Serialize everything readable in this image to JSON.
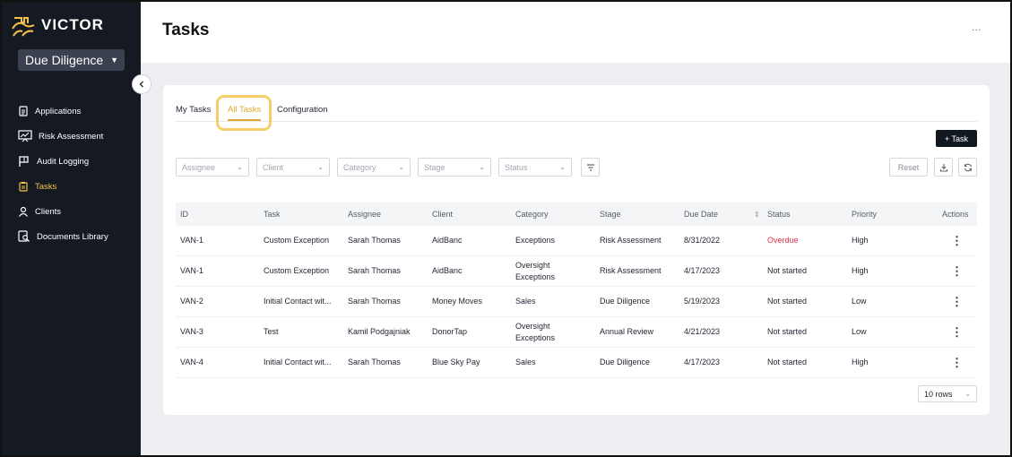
{
  "app": {
    "logo_text": "VICTOR",
    "module": "Due Diligence"
  },
  "sidebar": {
    "items": [
      {
        "label": "Applications",
        "icon": "document-icon"
      },
      {
        "label": "Risk Assessment",
        "icon": "chart-board-icon"
      },
      {
        "label": "Audit Logging",
        "icon": "flag-icon"
      },
      {
        "label": "Tasks",
        "icon": "clipboard-icon",
        "active": true
      },
      {
        "label": "Clients",
        "icon": "user-icon"
      },
      {
        "label": "Documents Library",
        "icon": "document-search-icon"
      }
    ]
  },
  "header": {
    "title": "Tasks",
    "more": "..."
  },
  "tabs": [
    "My Tasks",
    "All Tasks",
    "Configuration"
  ],
  "toolbar": {
    "add_task": "+ Task",
    "reset": "Reset"
  },
  "filters": [
    "Assignee",
    "Client",
    "Category",
    "Stage",
    "Status"
  ],
  "table": {
    "columns": [
      "ID",
      "Task",
      "Assignee",
      "Client",
      "Category",
      "Stage",
      "Due Date",
      "Status",
      "Priority",
      "Actions"
    ],
    "rows": [
      [
        "VAN-1",
        "Custom Exception",
        "Sarah Thomas",
        "AidBanc",
        "Exceptions",
        "Risk Assessment",
        "8/31/2022",
        "Overdue",
        "High"
      ],
      [
        "VAN-1",
        "Custom Exception",
        "Sarah Thomas",
        "AidBanc",
        "Oversight Exceptions",
        "Risk Assessment",
        "4/17/2023",
        "Not started",
        "High"
      ],
      [
        "VAN-2",
        "Initial Contact wit...",
        "Sarah Thomas",
        "Money Moves",
        "Sales",
        "Due Diligence",
        "5/19/2023",
        "Not started",
        "Low"
      ],
      [
        "VAN-3",
        "Test",
        "Kamil Podgajniak",
        "DonorTap",
        "Oversight Exceptions",
        "Annual Review",
        "4/21/2023",
        "Not started",
        "Low"
      ],
      [
        "VAN-4",
        "Initial Contact wit...",
        "Sarah Thomas",
        "Blue Sky Pay",
        "Sales",
        "Due Diligence",
        "4/17/2023",
        "Not started",
        "High"
      ]
    ]
  },
  "pagination": {
    "rows_per_page": "10 rows"
  },
  "colors": {
    "accent": "#e0a82e",
    "sidebar": "#151a22",
    "overdue": "#e0314b"
  }
}
